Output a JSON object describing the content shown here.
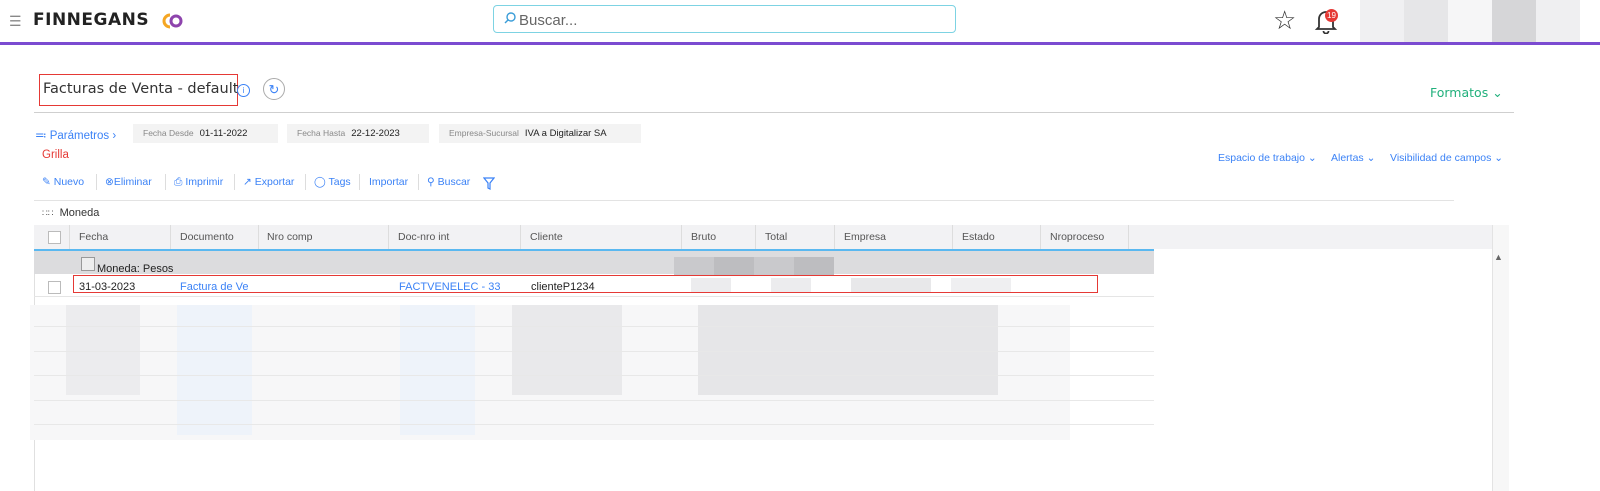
{
  "header": {
    "logo_text": "FINNEGANS",
    "search_placeholder": "Buscar...",
    "notification_count": "19"
  },
  "page": {
    "title": "Facturas de Venta - default",
    "formatos_label": "Formatos"
  },
  "params": {
    "label": "Parámetros",
    "fecha_desde_label": "Fecha Desde",
    "fecha_desde_value": "01-11-2022",
    "fecha_hasta_label": "Fecha Hasta",
    "fecha_hasta_value": "22-12-2023",
    "empresa_label": "Empresa-Sucursal",
    "empresa_value": "IVA a Digitalizar SA"
  },
  "view": {
    "grilla_label": "Grilla",
    "espacio_label": "Espacio de trabajo",
    "alertas_label": "Alertas",
    "visibilidad_label": "Visibilidad de campos"
  },
  "toolbar": {
    "nuevo": "Nuevo",
    "eliminar": "Eliminar",
    "imprimir": "Imprimir",
    "exportar": "Exportar",
    "tags": "Tags",
    "importar": "Importar",
    "buscar": "Buscar"
  },
  "grid": {
    "group_by_label": "Moneda",
    "columns": [
      "Fecha",
      "Documento",
      "Nro comp",
      "Doc-nro int",
      "Cliente",
      "Bruto",
      "Total",
      "Empresa",
      "Estado",
      "Nroproceso"
    ],
    "group_label": "Moneda: Pesos",
    "rows": [
      {
        "fecha": "31-03-2023",
        "documento": "Factura de Ve",
        "doc_nro_int": "FACTVENELEC - 33",
        "cliente": "clienteP1234"
      }
    ]
  },
  "colors": {
    "accent_purple": "#7b4bd1",
    "link_blue": "#3b82f6",
    "formatos_green": "#21b07c",
    "highlight_red": "#e53935"
  }
}
